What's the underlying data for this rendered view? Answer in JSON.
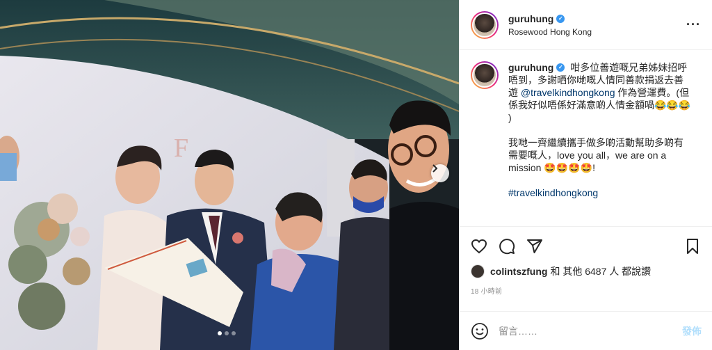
{
  "header": {
    "username": "guruhung",
    "location": "Rosewood Hong Kong",
    "more_label": "···"
  },
  "caption": {
    "username": "guruhung",
    "text_1": "咁多位善遊嘅兄弟姊妹招呼唔到，多謝晒你哋嘅人情同善款捐返去善遊",
    "mention": "@travelkindhongkong",
    "text_2": "作為營運費。(但係我好似唔係好滿意啲人情金額喎😂😂😂 )",
    "para_2": "我哋一齊繼續攜手做多啲活動幫助多啲有需要嘅人，love you all，we are on a mission 🤩🤩🤩🤩!",
    "hashtag": "#travelkindhongkong"
  },
  "likes": {
    "user": "colintszfung",
    "text": "和 其他 6487 人 都說讚"
  },
  "time": "18 小時前",
  "comment_box": {
    "placeholder": "留言……",
    "post_label": "發佈"
  },
  "carousel": {
    "total": 3,
    "active": 1
  },
  "icons": {
    "like": "heart-icon",
    "comment": "comment-icon",
    "share": "share-icon",
    "save": "bookmark-icon",
    "emoji": "emoji-icon",
    "next": "chevron-right-icon"
  },
  "colors": {
    "link": "#00376b",
    "verified": "#3897f0",
    "post_button_disabled": "#b2dffc",
    "meta_text": "#8e8e8e"
  }
}
